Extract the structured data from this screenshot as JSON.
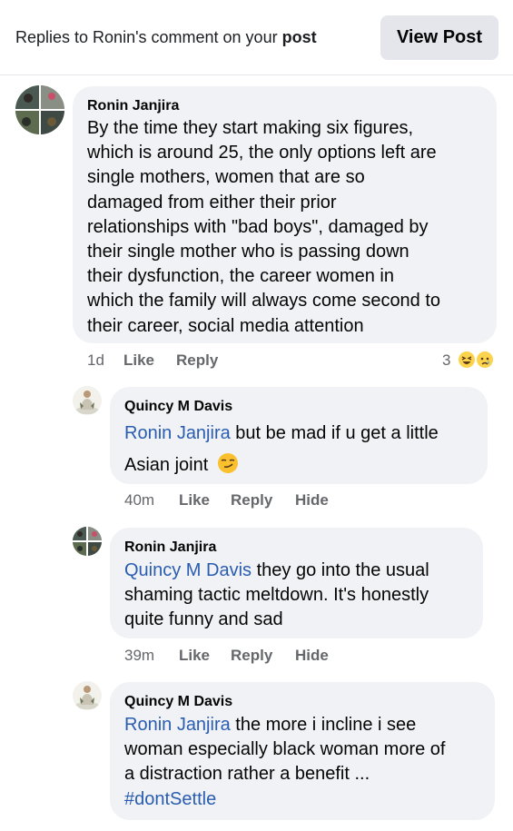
{
  "header": {
    "title_prefix": "Replies to Ronin's comment on your ",
    "title_bold": "post",
    "view_post_label": "View Post"
  },
  "comments": [
    {
      "author": "Ronin Janjira",
      "lines": [
        "By the time they start making six figures,",
        "which is around 25, the only options left are",
        "single mothers, women that are so",
        "damaged from either their prior",
        "relationships with \"bad boys\", damaged by",
        "their single mother who is passing down",
        "their dysfunction,  the career women in",
        "which the family will always come second to",
        "their career, social media attention"
      ],
      "time": "1d",
      "like": "Like",
      "reply": "Reply",
      "reaction_count": "3",
      "reactions": [
        "laughing-emoji",
        "crying-emoji"
      ]
    },
    {
      "author": "Quincy M Davis",
      "mention": "Ronin Janjira",
      "line1_rest": " but be mad if u get a little",
      "line2": "Asian joint",
      "emoji": "smirk-emoji",
      "time": "40m",
      "like": "Like",
      "reply": "Reply",
      "hide": "Hide"
    },
    {
      "author": "Ronin Janjira",
      "mention": "Quincy M Davis",
      "line1_rest": " they go into the usual",
      "line2": "shaming tactic meltdown. It's honestly",
      "line3": "quite funny and sad",
      "time": "39m",
      "like": "Like",
      "reply": "Reply",
      "hide": "Hide"
    },
    {
      "author": "Quincy M Davis",
      "mention": "Ronin Janjira",
      "line1_rest": " the more i incline i see",
      "line2": "woman especially black woman more of",
      "line3": "a distraction rather a benefit ...",
      "hashtag": "#dontSettle"
    }
  ],
  "colors": {
    "bubble": "#f0f2f5",
    "link": "#2a5db0",
    "meta": "#65676b",
    "button": "#e4e6eb"
  }
}
